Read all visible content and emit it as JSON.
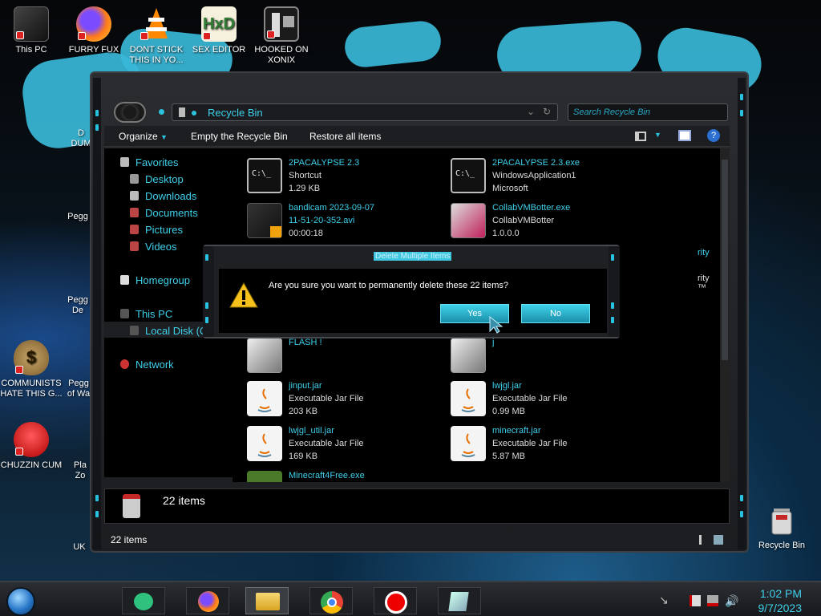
{
  "desktop_icons": [
    {
      "label": "This PC"
    },
    {
      "label": "FURRY FUX"
    },
    {
      "label": "DONT STICK THIS IN YO..."
    },
    {
      "label": "SEX EDITOR"
    },
    {
      "label": "HOOKED ON XONIX"
    },
    {
      "label": "COMMUNISTS HATE THIS G..."
    },
    {
      "label": "CHUZZIN CUM"
    },
    {
      "label": "Recycle Bin"
    }
  ],
  "partial_labels": [
    "D",
    "DUM",
    "Pegg",
    "Pegg",
    "De",
    "Pegg",
    "of Wa",
    "Pla",
    "Zo",
    "UK"
  ],
  "window": {
    "address": "Recycle Bin",
    "search_placeholder": "Search Recycle Bin",
    "toolbar": {
      "organize": "Organize",
      "empty": "Empty the Recycle Bin",
      "restore": "Restore all items"
    },
    "nav": {
      "favorites": "Favorites",
      "desktop": "Desktop",
      "downloads": "Downloads",
      "documents": "Documents",
      "pictures": "Pictures",
      "videos": "Videos",
      "homegroup": "Homegroup",
      "this_pc": "This PC",
      "local_disk": "Local Disk (C",
      "network": "Network"
    },
    "files": [
      {
        "name": "2PACALYPSE 2.3",
        "line2": "Shortcut",
        "line3": "1.29 KB",
        "icon": "console-icon"
      },
      {
        "name": "2PACALYPSE 2.3.exe",
        "line2": "WindowsApplication1",
        "line3": "Microsoft",
        "icon": "console-icon"
      },
      {
        "name": "bandicam 2023-09-07",
        "line2": "11-51-20-352.avi",
        "line3": "00:00:18",
        "icon": "video-icon"
      },
      {
        "name": "CollabVMBotter.exe",
        "line2": "CollabVMBotter",
        "line3": "1.0.0.0",
        "icon": "app-icon"
      },
      {
        "name": "FLASH !",
        "line2": "",
        "line3": "",
        "icon": "folder-icon"
      },
      {
        "name": "j",
        "line2": "",
        "line3": "",
        "icon": "folder-icon"
      },
      {
        "name": "jinput.jar",
        "line2": "Executable Jar File",
        "line3": "203 KB",
        "icon": "java-icon"
      },
      {
        "name": "lwjgl.jar",
        "line2": "Executable Jar File",
        "line3": "0.99 MB",
        "icon": "java-icon"
      },
      {
        "name": "lwjgl_util.jar",
        "line2": "Executable Jar File",
        "line3": "169 KB",
        "icon": "java-icon"
      },
      {
        "name": "minecraft.jar",
        "line2": "Executable Jar File",
        "line3": "5.87 MB",
        "icon": "java-icon"
      },
      {
        "name": "Minecraft4Free.exe",
        "line2": "",
        "line3": "",
        "icon": "app-icon"
      }
    ],
    "partial_right": [
      "rity",
      "rity ™"
    ],
    "details_count": "22 items",
    "status_count": "22 items"
  },
  "dialog": {
    "title": "Delete Multiple Items",
    "message": "Are you sure you want to permanently delete these 22 items?",
    "yes": "Yes",
    "no": "No"
  },
  "taskbar": {
    "time": "1:02 PM",
    "date": "9/7/2023"
  },
  "colors": {
    "accent": "#3fd0ea",
    "button": "#2aaecb"
  }
}
